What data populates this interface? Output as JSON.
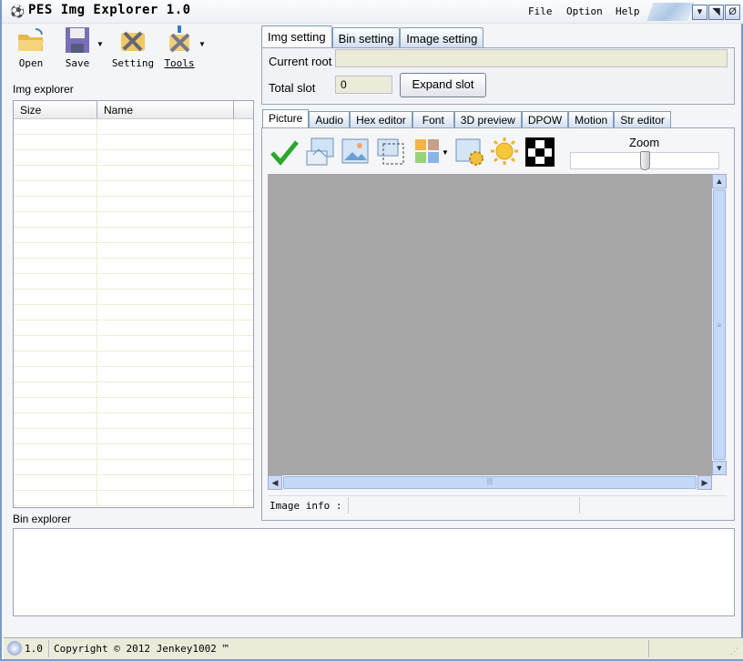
{
  "window": {
    "title": "PES Img Explorer 1.0",
    "menu": [
      "File",
      "Option",
      "Help"
    ],
    "controls": {
      "minimize": "▾",
      "maximize": "◥",
      "close": "Ø"
    }
  },
  "toolbar": {
    "open": "Open",
    "save": "Save",
    "setting": "Setting",
    "tools": "Tools"
  },
  "img_explorer": {
    "label": "Img explorer",
    "columns": [
      "Size",
      "Name"
    ]
  },
  "settings_tabs": [
    "Img setting",
    "Bin setting",
    "Image setting"
  ],
  "img_setting": {
    "current_root_label": "Current root",
    "current_root_value": "",
    "total_slot_label": "Total slot",
    "total_slot_value": "0",
    "expand_slot_button": "Expand slot"
  },
  "editor_tabs": [
    "Picture",
    "Audio",
    "Hex editor",
    "Font",
    "3D preview",
    "DPOW",
    "Motion",
    "Str editor"
  ],
  "picture": {
    "zoom_label": "Zoom",
    "zoom_level": 0.5,
    "image_info_label": "Image info :"
  },
  "bin_explorer": {
    "label": "Bin explorer"
  },
  "status_bar": {
    "version": "1.0",
    "copyright": "Copyright © 2012 Jenkey1002 ™"
  }
}
